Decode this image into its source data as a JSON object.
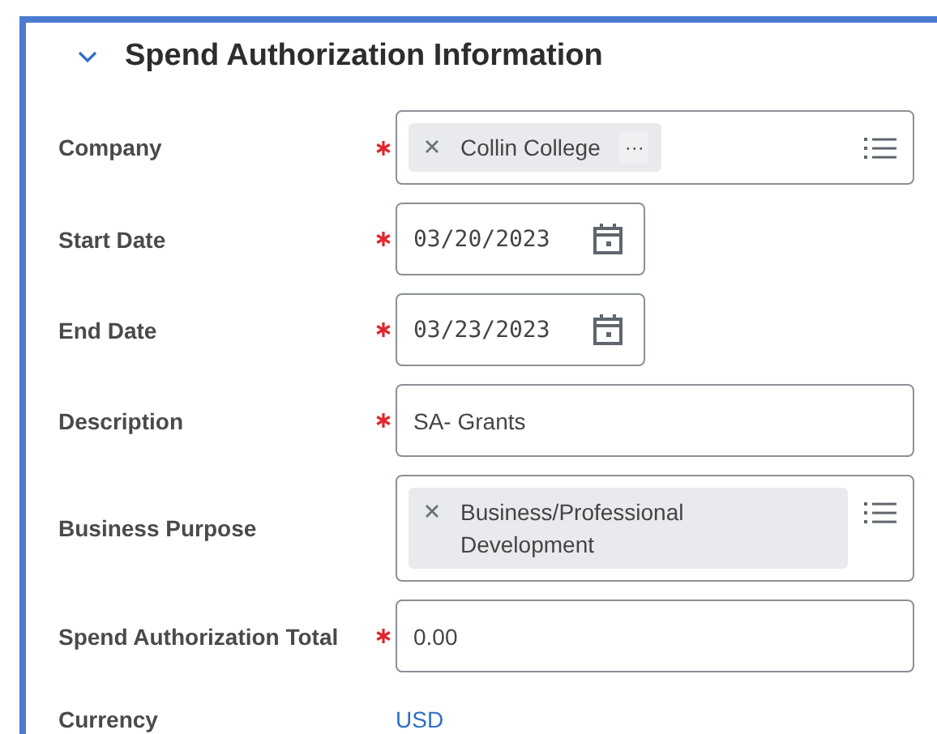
{
  "section": {
    "title": "Spend Authorization Information",
    "expanded": true
  },
  "fields": [
    {
      "label": "Company",
      "required": true,
      "kind": "select",
      "pills": [
        {
          "text": "Collin College",
          "menu": "···"
        }
      ]
    },
    {
      "label": "Start Date",
      "required": true,
      "kind": "date",
      "value": "03/20/2023"
    },
    {
      "label": "End Date",
      "required": true,
      "kind": "date",
      "value": "03/23/2023"
    },
    {
      "label": "Description",
      "required": true,
      "kind": "text",
      "value": "SA- Grants"
    },
    {
      "label": "Business Purpose",
      "required": false,
      "kind": "select",
      "pills": [
        {
          "text": "Business/Professional Development"
        }
      ]
    },
    {
      "label": "Spend Authorization Total",
      "required": true,
      "kind": "text",
      "value": "0.00"
    },
    {
      "label": "Currency",
      "required": false,
      "kind": "link",
      "value": "USD"
    }
  ]
}
